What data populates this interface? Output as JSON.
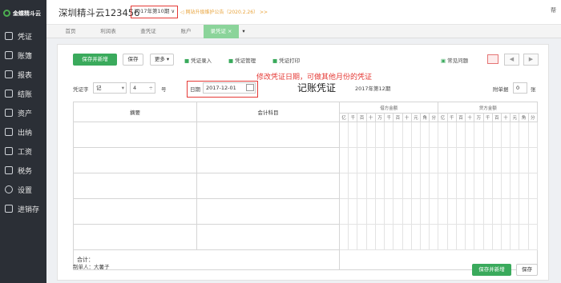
{
  "sidebar": {
    "logo": "金蝶精斗云",
    "items": [
      {
        "label": "凭证"
      },
      {
        "label": "账簿"
      },
      {
        "label": "报表"
      },
      {
        "label": "结账"
      },
      {
        "label": "资产"
      },
      {
        "label": "出纳"
      },
      {
        "label": "工资"
      },
      {
        "label": "税务"
      },
      {
        "label": "设置"
      },
      {
        "label": "进销存"
      }
    ]
  },
  "header": {
    "company": "深圳精斗云123456",
    "period": "2017年第10期 ∨",
    "notice": "网站升级维护公告（2020.2.26） >>",
    "help": "帮"
  },
  "tabs": [
    "首页",
    "利润表",
    "查凭证",
    "账户",
    "录凭证"
  ],
  "toolbar": {
    "save_new": "保存并新增",
    "save": "保存",
    "more": "更多 ▾",
    "entry": "凭证录入",
    "manage": "凭证管理",
    "print": "凭证打印",
    "faq": "常见问题"
  },
  "form": {
    "word_label": "凭证字",
    "word_value": "记",
    "number_value": "4",
    "number_suffix": "号",
    "date_label": "日期",
    "date_value": "2017-12-01",
    "title": "记账凭证",
    "period": "2017年第12期",
    "attach_label": "附单据",
    "attach_value": "0",
    "attach_unit": "张"
  },
  "annotation": "修改凭证日期，可做其他月份的凭证",
  "table": {
    "summary": "摘要",
    "account": "会计科目",
    "debit": "借方金额",
    "credit": "贷方金额",
    "digits": [
      "亿",
      "千",
      "百",
      "十",
      "万",
      "千",
      "百",
      "十",
      "元",
      "角",
      "分"
    ],
    "total": "合计："
  },
  "footer": {
    "maker_label": "制单人：",
    "maker": "大薯子",
    "save_new": "保存并新增",
    "save": "保存"
  }
}
